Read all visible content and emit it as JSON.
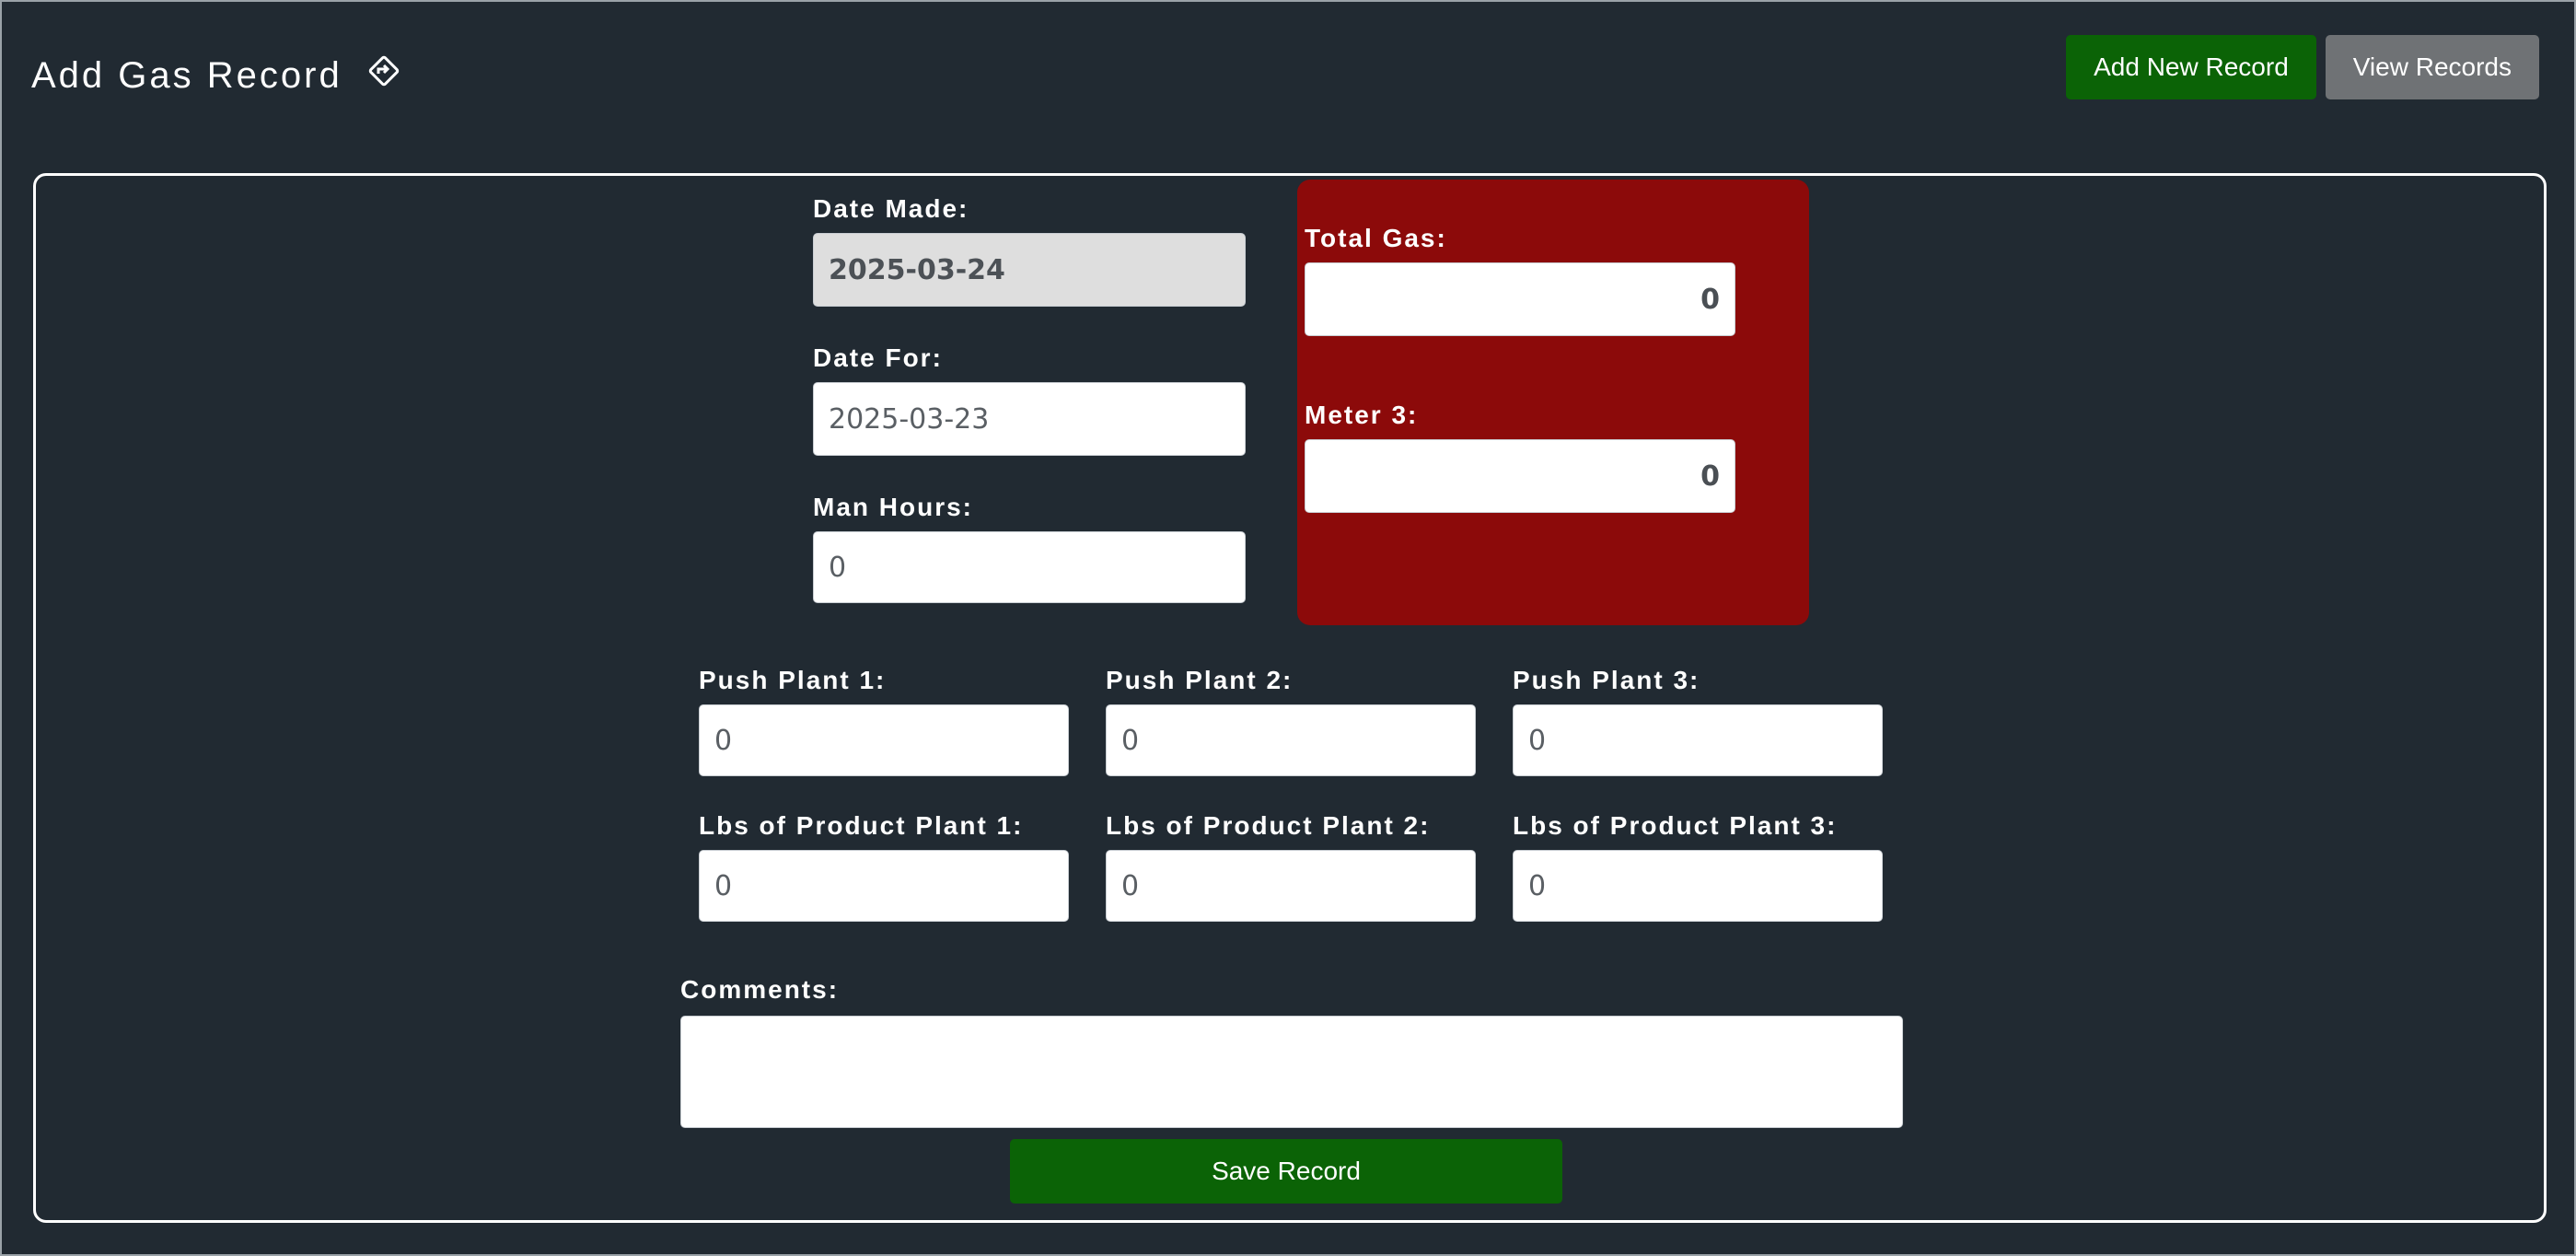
{
  "header": {
    "title": "Add Gas Record",
    "title_icon": "route-directions-icon",
    "add_new_label": "Add New Record",
    "view_records_label": "View Records"
  },
  "form": {
    "date_made": {
      "label": "Date Made:",
      "value": "2025-03-24"
    },
    "date_for": {
      "label": "Date For:",
      "value": "2025-03-23"
    },
    "man_hours": {
      "label": "Man Hours:",
      "value": "0"
    },
    "total_gas": {
      "label": "Total Gas:",
      "value": "0"
    },
    "meter3": {
      "label": "Meter 3:",
      "value": "0"
    },
    "push_plant_1": {
      "label": "Push Plant 1:",
      "value": "0"
    },
    "push_plant_2": {
      "label": "Push Plant 2:",
      "value": "0"
    },
    "push_plant_3": {
      "label": "Push Plant 3:",
      "value": "0"
    },
    "lbs_plant_1": {
      "label": "Lbs of Product Plant 1:",
      "value": "0"
    },
    "lbs_plant_2": {
      "label": "Lbs of Product Plant 2:",
      "value": "0"
    },
    "lbs_plant_3": {
      "label": "Lbs of Product Plant 3:",
      "value": "0"
    },
    "comments": {
      "label": "Comments:",
      "value": ""
    },
    "save_label": "Save Record"
  },
  "colors": {
    "background": "#212a32",
    "accent_green": "#0b6306",
    "accent_gray": "#6f7275",
    "gas_panel_red": "#8c0a0a"
  }
}
